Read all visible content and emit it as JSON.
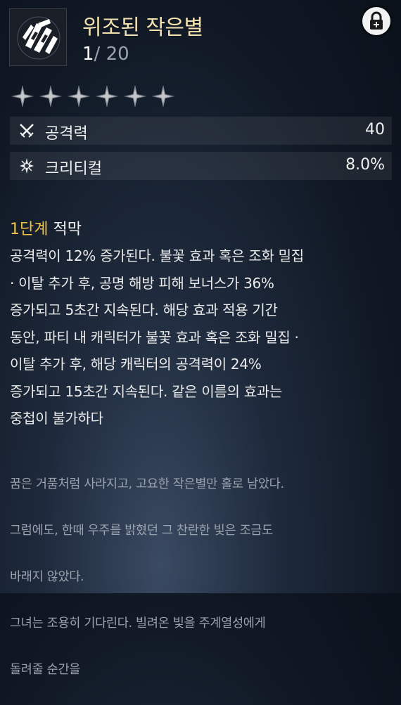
{
  "weapon": {
    "icon": "weapon-emblem-icon",
    "title": "위조된 작은별",
    "level_current": "1",
    "level_max": "/ 20",
    "lock_icon": "lock-icon",
    "stars": {
      "filled": 0,
      "total": 6
    }
  },
  "stats": [
    {
      "icon": "crossed-swords-icon",
      "label": "공격력",
      "value": "40"
    },
    {
      "icon": "critical-star-icon",
      "label": "크리티컬",
      "value": "8.0%"
    }
  ],
  "effect": {
    "stage": "1단계",
    "name": "적막",
    "lines": [
      "공격력이 12% 증가된다. 불꽃 효과 혹은 조화 밀집",
      "· 이탈 추가 후, 공명 해방 피해 보너스가 36%",
      "증가되고 5초간 지속된다. 해당 효과 적용 기간",
      "동안, 파티 내 캐릭터가 불꽃 효과 혹은 조화 밀집 ·",
      "이탈 추가 후, 해당 캐릭터의 공격력이 24%",
      "증가되고 15초간 지속된다. 같은 이름의 효과는",
      "중첩이 불가하다"
    ]
  },
  "lore": {
    "lines": [
      "꿈은 거품처럼 사라지고, 고요한 작은별만 홀로 남았다.",
      "그럼에도, 한때 우주를 밝혔던 그 찬란한 빛은 조금도",
      "바래지 않았다.",
      "그녀는 조용히 기다린다. 빌려온 빛을 주계열성에게",
      "돌려줄 순간을"
    ]
  },
  "colors": {
    "title": "#f3e2b0",
    "stage": "#f0c24a",
    "lore": "#9aa3ae"
  }
}
